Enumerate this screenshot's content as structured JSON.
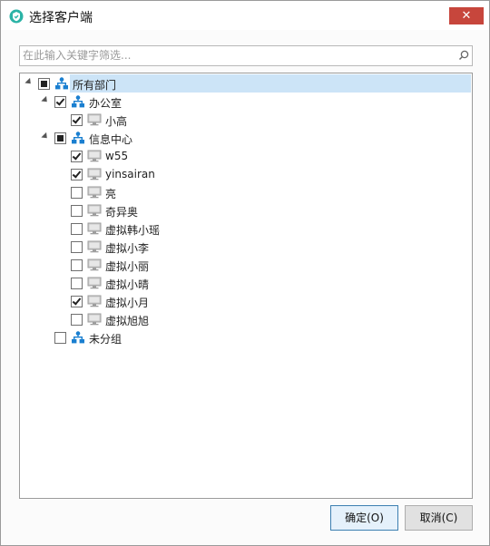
{
  "window": {
    "title": "选择客户端",
    "close_label": "✕"
  },
  "search": {
    "placeholder": "在此输入关键字筛选..."
  },
  "tree": {
    "root": {
      "label": "所有部门",
      "state": "partial"
    },
    "groups": [
      {
        "label": "办公室",
        "state": "checked",
        "clients": [
          {
            "label": "小高",
            "checked": true
          }
        ]
      },
      {
        "label": "信息中心",
        "state": "partial",
        "clients": [
          {
            "label": "w55",
            "checked": true
          },
          {
            "label": "yinsairan",
            "checked": true
          },
          {
            "label": "亮",
            "checked": false
          },
          {
            "label": "奇异奥",
            "checked": false
          },
          {
            "label": "虚拟韩小瑶",
            "checked": false
          },
          {
            "label": "虚拟小李",
            "checked": false
          },
          {
            "label": "虚拟小丽",
            "checked": false
          },
          {
            "label": "虚拟小晴",
            "checked": false
          },
          {
            "label": "虚拟小月",
            "checked": true
          },
          {
            "label": "虚拟旭旭",
            "checked": false
          }
        ]
      },
      {
        "label": "未分组",
        "state": "unchecked",
        "clients": []
      }
    ]
  },
  "buttons": {
    "ok": "确定(O)",
    "cancel": "取消(C)"
  },
  "colors": {
    "accent": "#3c7fb1",
    "selection": "#cce4f7",
    "close": "#c7463c",
    "org_icon": "#1a7fd0"
  }
}
